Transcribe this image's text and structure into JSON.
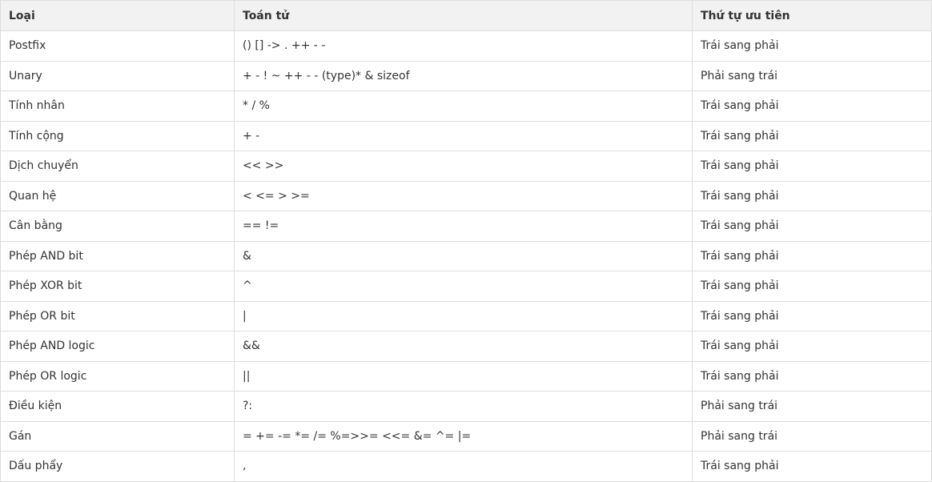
{
  "table": {
    "headers": [
      "Loại",
      "Toán tử",
      "Thứ tự ưu tiên"
    ],
    "rows": [
      [
        "Postfix",
        "() [] -> . ++ - -",
        "Trái sang phải"
      ],
      [
        "Unary",
        "+ - ! ~ ++ - - (type)* & sizeof",
        "Phải sang trái"
      ],
      [
        "Tính nhân",
        "* / %",
        "Trái sang phải"
      ],
      [
        "Tính cộng",
        "+ -",
        "Trái sang phải"
      ],
      [
        "Dịch chuyển",
        "<< >>",
        "Trái sang phải"
      ],
      [
        "Quan hệ",
        "< <= > >=",
        "Trái sang phải"
      ],
      [
        "Cân bằng",
        "== !=",
        "Trái sang phải"
      ],
      [
        "Phép AND bit",
        "&",
        "Trái sang phải"
      ],
      [
        "Phép XOR bit",
        "^",
        "Trái sang phải"
      ],
      [
        "Phép OR bit",
        "|",
        "Trái sang phải"
      ],
      [
        "Phép AND logic",
        "&&",
        "Trái sang phải"
      ],
      [
        "Phép OR logic",
        "||",
        "Trái sang phải"
      ],
      [
        "Điều kiện",
        "?:",
        "Phải sang trái"
      ],
      [
        "Gán",
        "= += -= *= /= %=>>= <<= &= ^= |=",
        "Phải sang trái"
      ],
      [
        "Dấu phẩy",
        ",",
        "Trái sang phải"
      ]
    ]
  }
}
